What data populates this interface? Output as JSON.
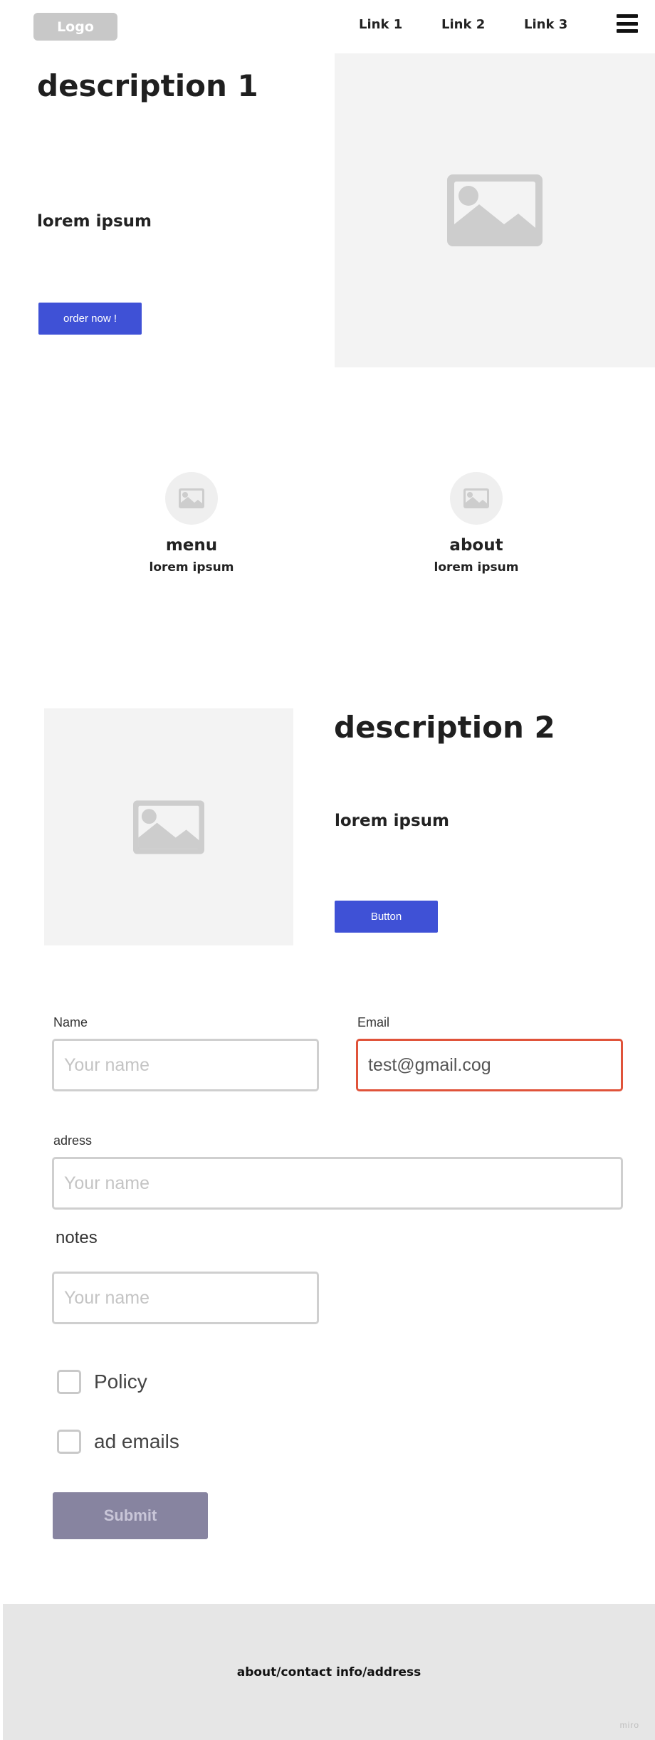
{
  "header": {
    "logo": "Logo",
    "nav": [
      {
        "label": "Link 1"
      },
      {
        "label": "Link 2"
      },
      {
        "label": "Link 3"
      }
    ],
    "menu_icon": "hamburger-icon"
  },
  "hero": {
    "title": "description 1",
    "subtitle": "lorem ipsum",
    "button": "order now !",
    "image_icon": "image-placeholder-icon"
  },
  "features": [
    {
      "title": "menu",
      "text": "lorem ipsum",
      "icon": "image-icon"
    },
    {
      "title": "about",
      "text": "lorem ipsum",
      "icon": "image-icon"
    }
  ],
  "section2": {
    "title": "description 2",
    "subtitle": "lorem ipsum",
    "button": "Button",
    "image_icon": "image-placeholder-icon"
  },
  "form": {
    "name": {
      "label": "Name",
      "placeholder": "Your name",
      "value": ""
    },
    "email": {
      "label": "Email",
      "placeholder": "",
      "value": "test@gmail.cog"
    },
    "address": {
      "label": "adress",
      "placeholder": "Your name",
      "value": ""
    },
    "notes": {
      "label": "notes",
      "placeholder": "Your name",
      "value": ""
    },
    "checkboxes": [
      {
        "label": "Policy",
        "checked": false
      },
      {
        "label": "ad emails",
        "checked": false
      }
    ],
    "submit": "Submit"
  },
  "footer": {
    "text": "about/contact info/address",
    "watermark": "miro"
  },
  "colors": {
    "accent": "#3f51d6",
    "error_border": "#e0533a",
    "submit_bg": "#8784a0",
    "placeholder_bg": "#f3f3f3",
    "footer_bg": "#e6e6e6"
  }
}
